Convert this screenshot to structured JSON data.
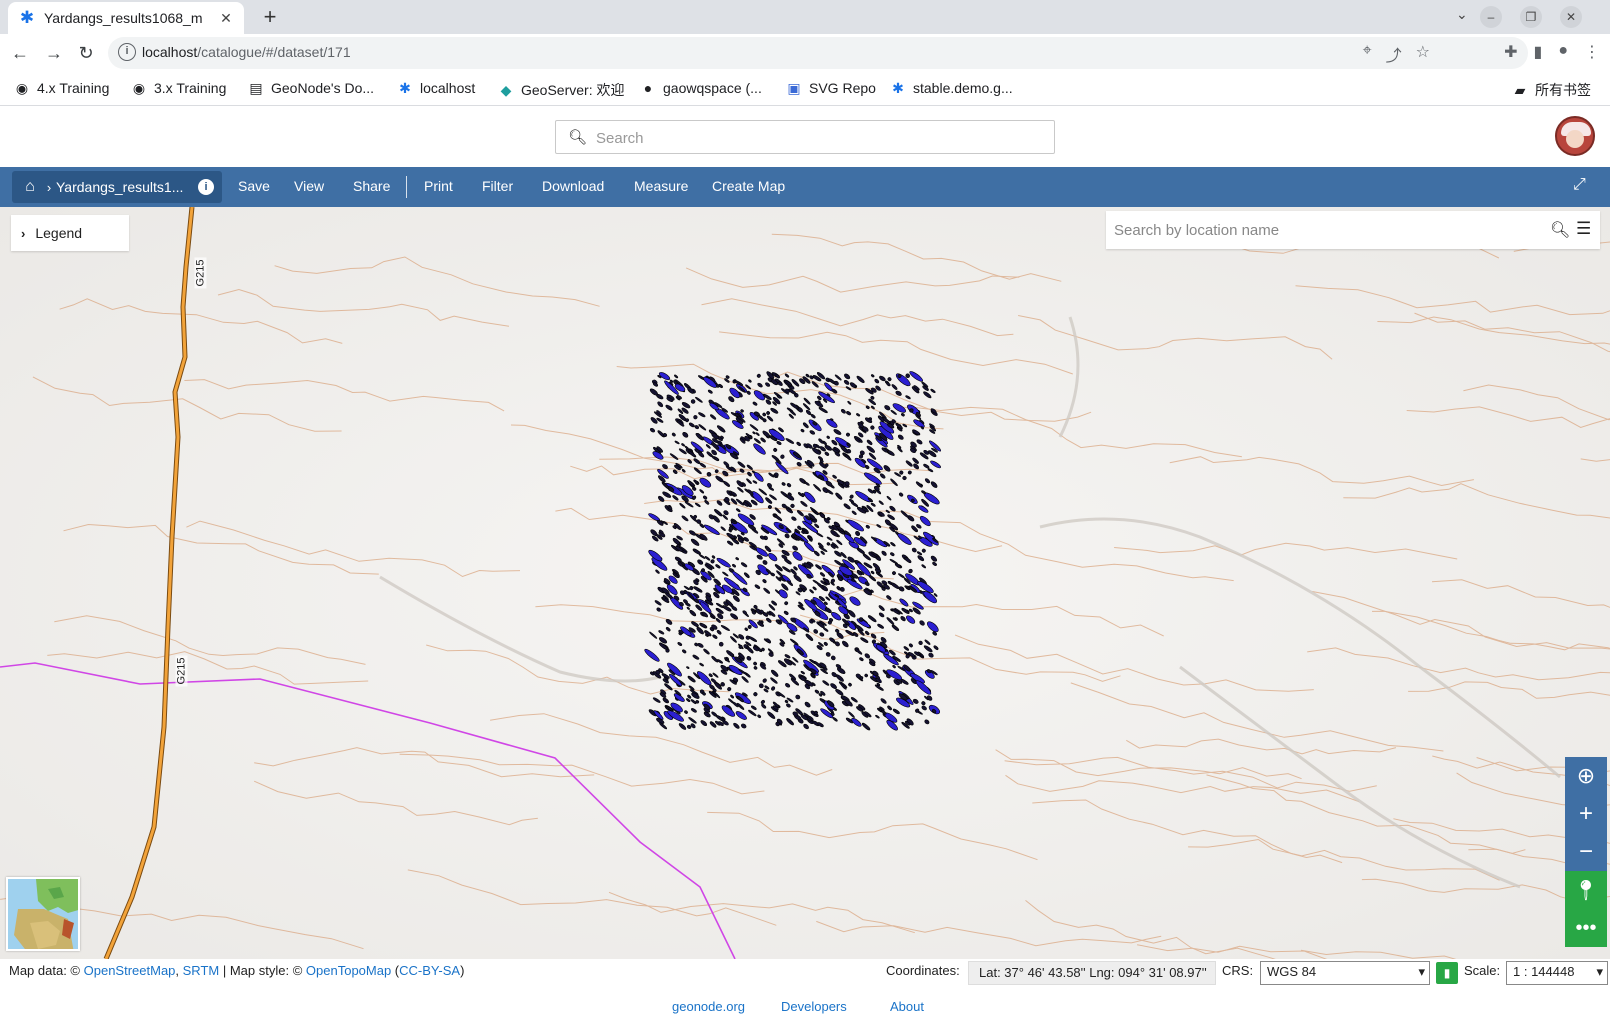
{
  "browser": {
    "tab_title": "Yardangs_results1068_m",
    "url_host": "localhost",
    "url_path": "/catalogue/#/dataset/171",
    "bookmarks": [
      {
        "label": "4.x Training",
        "icon": "globe-icon"
      },
      {
        "label": "3.x Training",
        "icon": "globe-icon"
      },
      {
        "label": "GeoNode's Do...",
        "icon": "book-icon"
      },
      {
        "label": "localhost",
        "icon": "geonode-icon"
      },
      {
        "label": "GeoServer: 欢迎",
        "icon": "geoserver-icon"
      },
      {
        "label": "gaowqspace (...",
        "icon": "github-icon"
      },
      {
        "label": "SVG Repo",
        "icon": "svgrepo-icon"
      },
      {
        "label": "stable.demo.g...",
        "icon": "geonode-icon"
      }
    ],
    "all_bookmarks": "所有书签"
  },
  "header": {
    "search_placeholder": "Search"
  },
  "toolbar": {
    "breadcrumb_name": "Yardangs_results1...",
    "items": [
      "Save",
      "View",
      "Share",
      "Print",
      "Filter",
      "Download",
      "Measure",
      "Create Map"
    ]
  },
  "map": {
    "legend_label": "Legend",
    "location_search_placeholder": "Search by location name",
    "road_label": "G215"
  },
  "status": {
    "attribution_prefix": "Map data: © ",
    "osm": "OpenStreetMap",
    "srtm": "SRTM",
    "style_prefix": " | Map style: © ",
    "opentopomap": "OpenTopoMap",
    "ccbysa": "CC-BY-SA",
    "coordinates_label": "Coordinates:",
    "coordinates_value": "Lat: 37° 46' 43.58'' Lng: 094° 31' 08.97''",
    "crs_label": "CRS:",
    "crs_value": "WGS 84",
    "scale_label": "Scale:",
    "scale_value": "1 : 144448"
  },
  "footer": {
    "links": [
      "geonode.org",
      "Developers",
      "About"
    ]
  },
  "colors": {
    "toolbar_bg": "#3f6fa4",
    "breadcrumb_bg": "#2c5786",
    "road": "#e08a1e",
    "boundary": "#d046e6",
    "contour": "#d9a37c",
    "yardang_fill": "#2b1fd1",
    "locate_button": "#28a745"
  }
}
